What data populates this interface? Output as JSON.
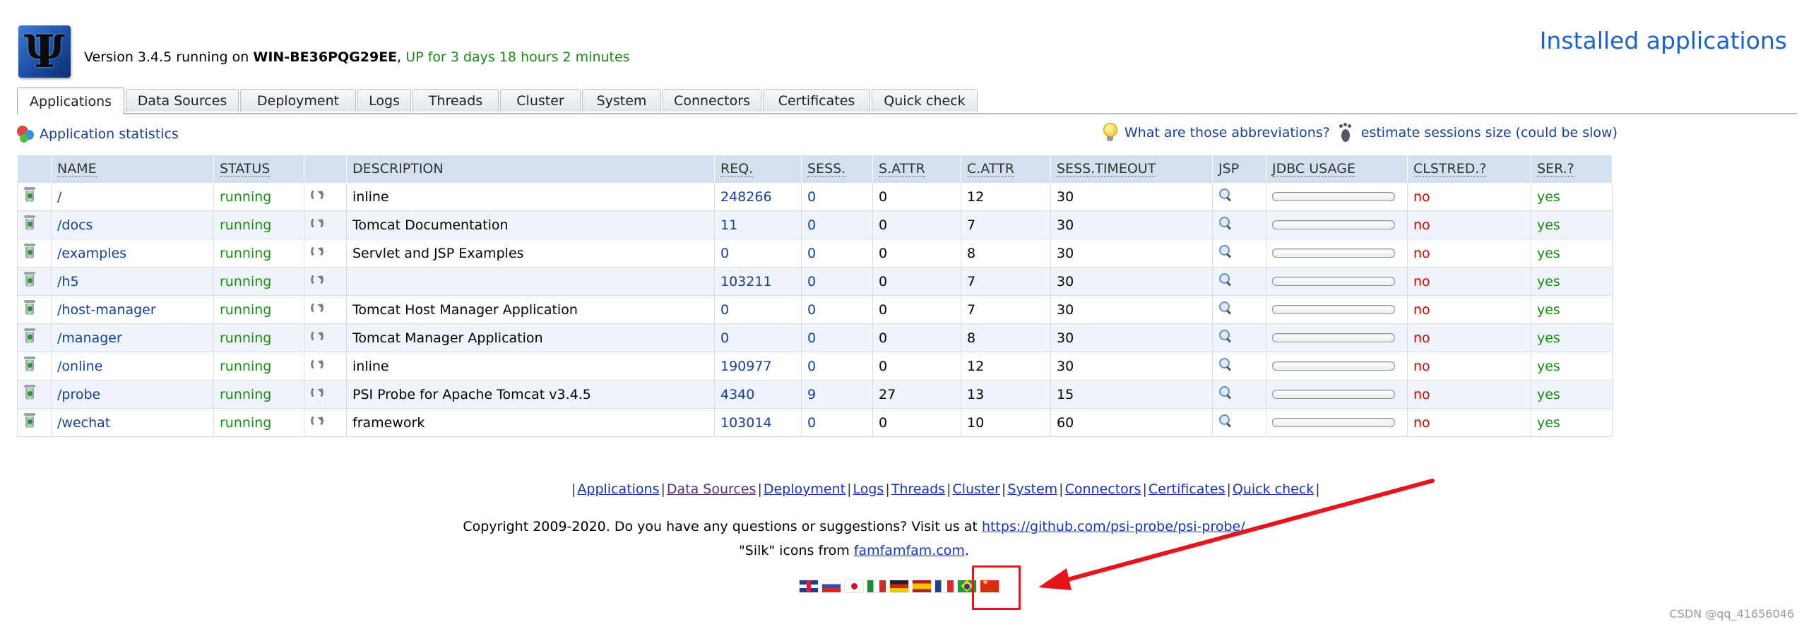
{
  "header": {
    "logo_glyph": "Ψ",
    "version_prefix": "Version 3.4.5 running on",
    "host": "WIN-BE36PQG29EE",
    "uptime": "UP for 3 days 18 hours 2 minutes",
    "page_title": "Installed applications"
  },
  "tabs": [
    {
      "label": "Applications",
      "active": true
    },
    {
      "label": "Data Sources"
    },
    {
      "label": "Deployment"
    },
    {
      "label": "Logs"
    },
    {
      "label": "Threads"
    },
    {
      "label": "Cluster"
    },
    {
      "label": "System"
    },
    {
      "label": "Connectors"
    },
    {
      "label": "Certificates"
    },
    {
      "label": "Quick check"
    }
  ],
  "toolbar": {
    "stats_label": "Application statistics",
    "abbrev_label": "What are those abbreviations?",
    "estimate_label": "estimate sessions size (could be slow)"
  },
  "table": {
    "headers": {
      "name": "NAME",
      "status": "STATUS",
      "description": "DESCRIPTION",
      "req": "REQ.",
      "sess": "SESS.",
      "sattr": "S.ATTR",
      "cattr": "C.ATTR",
      "timeout": "SESS.TIMEOUT",
      "jsp": "JSP",
      "jdbc": "JDBC USAGE",
      "clstred": "CLSTRED.?",
      "ser": "SER.?"
    },
    "rows": [
      {
        "name": "/",
        "status": "running",
        "description": "inline",
        "req": "248266",
        "sess": "0",
        "sattr": "0",
        "cattr": "12",
        "timeout": "30",
        "jdbc": 0,
        "clstred": "no",
        "ser": "yes"
      },
      {
        "name": "/docs",
        "status": "running",
        "description": "Tomcat Documentation",
        "req": "11",
        "sess": "0",
        "sattr": "0",
        "cattr": "7",
        "timeout": "30",
        "jdbc": 0,
        "clstred": "no",
        "ser": "yes"
      },
      {
        "name": "/examples",
        "status": "running",
        "description": "Servlet and JSP Examples",
        "req": "0",
        "sess": "0",
        "sattr": "0",
        "cattr": "8",
        "timeout": "30",
        "jdbc": 0,
        "clstred": "no",
        "ser": "yes"
      },
      {
        "name": "/h5",
        "status": "running",
        "description": "",
        "req": "103211",
        "sess": "0",
        "sattr": "0",
        "cattr": "7",
        "timeout": "30",
        "jdbc": 0,
        "clstred": "no",
        "ser": "yes"
      },
      {
        "name": "/host-manager",
        "status": "running",
        "description": "Tomcat Host Manager Application",
        "req": "0",
        "sess": "0",
        "sattr": "0",
        "cattr": "7",
        "timeout": "30",
        "jdbc": 0,
        "clstred": "no",
        "ser": "yes"
      },
      {
        "name": "/manager",
        "status": "running",
        "description": "Tomcat Manager Application",
        "req": "0",
        "sess": "0",
        "sattr": "0",
        "cattr": "8",
        "timeout": "30",
        "jdbc": 0,
        "clstred": "no",
        "ser": "yes"
      },
      {
        "name": "/online",
        "status": "running",
        "description": "inline",
        "req": "190977",
        "sess": "0",
        "sattr": "0",
        "cattr": "12",
        "timeout": "30",
        "jdbc": 0,
        "clstred": "no",
        "ser": "yes"
      },
      {
        "name": "/probe",
        "status": "running",
        "description": "PSI Probe for Apache Tomcat v3.4.5",
        "req": "4340",
        "sess": "9",
        "sattr": "27",
        "cattr": "13",
        "timeout": "15",
        "jdbc": 0,
        "clstred": "no",
        "ser": "yes"
      },
      {
        "name": "/wechat",
        "status": "running",
        "description": "framework",
        "req": "103014",
        "sess": "0",
        "sattr": "0",
        "cattr": "10",
        "timeout": "60",
        "jdbc": 0,
        "clstred": "no",
        "ser": "yes"
      }
    ]
  },
  "footer": {
    "nav": [
      "Applications",
      "Data Sources",
      "Deployment",
      "Logs",
      "Threads",
      "Cluster",
      "System",
      "Connectors",
      "Certificates",
      "Quick check"
    ],
    "copyright_text": "Copyright 2009-2020. Do you have any questions or suggestions? Visit us at",
    "copyright_link": "https://github.com/psi-probe/psi-probe/",
    "silk_prefix": "\"Silk\" icons from",
    "silk_link": "famfamfam.com",
    "silk_suffix": ".",
    "flags": [
      "gb",
      "ru",
      "jp",
      "it",
      "de",
      "es",
      "fr",
      "br",
      "cn"
    ]
  },
  "watermark": "CSDN @qq_41656046",
  "colors": {
    "accent": "#1e62c8",
    "running": "#1b8a14",
    "no": "#d00000",
    "header_row": "#d3e1ef",
    "annotation": "#e8141b"
  }
}
